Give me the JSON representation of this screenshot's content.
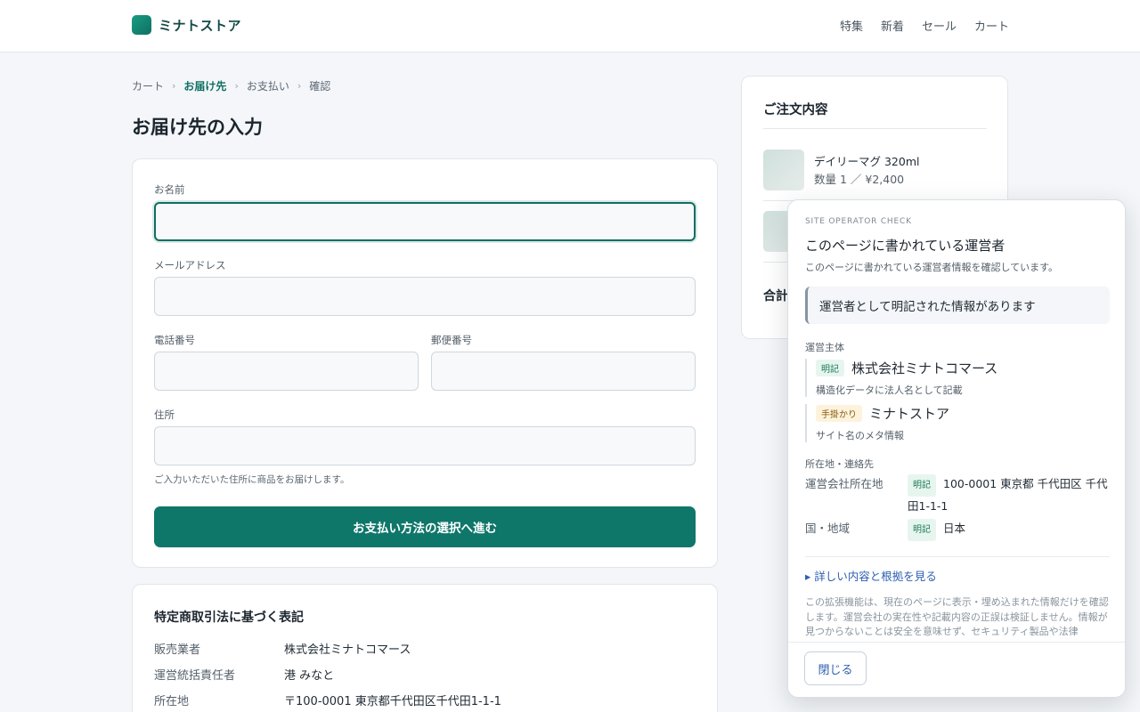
{
  "header": {
    "logo_text": "ミナトストア",
    "nav": [
      "特集",
      "新着",
      "セール",
      "カート"
    ]
  },
  "breadcrumb": {
    "items": [
      "カート",
      "お届け先",
      "お支払い",
      "確認"
    ],
    "separator": "›"
  },
  "page_title": "お届け先の入力",
  "form": {
    "name_label": "お名前",
    "name_value": "",
    "email_label": "メールアドレス",
    "email_value": "",
    "phone_label": "電話番号",
    "phone_value": "",
    "zip_label": "郵便番号",
    "zip_value": "",
    "address_label": "住所",
    "address_value": "",
    "address_hint": "ご入力いただいた住所に商品をお届けします。",
    "submit_label": "お支払い方法の選択へ進む"
  },
  "legal": {
    "title": "特定商取引法に基づく表記",
    "rows": [
      {
        "k": "販売業者",
        "v": "株式会社ミナトコマース"
      },
      {
        "k": "運営統括責任者",
        "v": "港 みなと"
      },
      {
        "k": "所在地",
        "v": "〒100-0001 東京都千代田区千代田1-1-1"
      }
    ]
  },
  "order": {
    "title": "ご注文内容",
    "items": [
      {
        "name": "デイリーマグ 320ml",
        "meta": "数量 1 ／ ¥2,400"
      }
    ],
    "total_label": "合計"
  },
  "panel": {
    "eyebrow": "SITE OPERATOR CHECK",
    "title": "このページに書かれている運営者",
    "subtitle": "このページに書かれている運営者情報を確認しています。",
    "status": "運営者として明記された情報があります",
    "entity_section": "運営主体",
    "entities": [
      {
        "badge": "明記",
        "name": "株式会社ミナトコマース",
        "note": "構造化データに法人名として記載"
      },
      {
        "badge": "手掛かり",
        "name": "ミナトストア",
        "note": "サイト名のメタ情報"
      }
    ],
    "location_section": "所在地・連絡先",
    "locations": [
      {
        "k": "運営会社所在地",
        "badge": "明記",
        "v": "100-0001 東京都 千代田区 千代田1-1-1"
      },
      {
        "k": "国・地域",
        "badge": "明記",
        "v": "日本"
      }
    ],
    "details_link": "▸ 詳しい内容と根拠を見る",
    "disclaimer": "この拡張機能は、現在のページに表示・埋め込まれた情報だけを確認します。運営会社の実在性や記載内容の正誤は検証しません。情報が見つからないことは安全を意味せず、セキュリティ製品や法律",
    "close_label": "閉じる"
  }
}
